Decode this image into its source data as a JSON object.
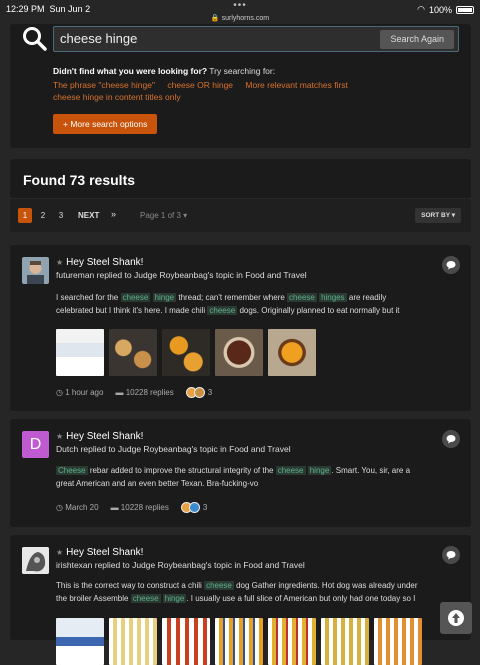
{
  "status": {
    "time": "12:29 PM",
    "date": "Sun Jun 2",
    "url": "surlyhorns.com",
    "battery": "100%"
  },
  "search": {
    "query": "cheese hinge",
    "button": "Search Again"
  },
  "suggestions": {
    "lead_bold": "Didn't find what you were looking for?",
    "lead": " Try searching for:",
    "items": [
      "The phrase \"cheese hinge\"",
      "cheese OR hinge",
      "More relevant matches first",
      "cheese hinge in content titles only"
    ]
  },
  "more_options": "More search options",
  "results_title": "Found 73 results",
  "pager": {
    "pages": [
      "1",
      "2",
      "3"
    ],
    "next": "NEXT",
    "last": "»",
    "page_of": "Page 1 of 3 ▾",
    "sort": "SORT BY ▾"
  },
  "results": [
    {
      "title": "Hey Steel Shank!",
      "sub": "futureman replied to Judge Roybeanbag's topic in Food and Travel",
      "time": "1 hour ago",
      "replies": "10228 replies",
      "reactions": "3"
    },
    {
      "title": "Hey Steel Shank!",
      "sub": "Dutch replied to Judge Roybeanbag's topic in Food and Travel",
      "avatar_letter": "D",
      "time": "March 20",
      "replies": "10228 replies",
      "reactions": "3"
    },
    {
      "title": "Hey Steel Shank!",
      "sub": "irishtexan replied to Judge Roybeanbag's topic in Food and Travel"
    }
  ],
  "body_words": {
    "r1a": "I searched for the",
    "r1b": "cheese",
    "r1c": "hinge",
    "r1d": "thread; can't remember where",
    "r1e": "cheese",
    "r1f": "hinges",
    "r1g": "are readily",
    "r1h": "celebrated but I think it's here. I made chili",
    "r1i": "cheese",
    "r1j": "dogs. Originally planned to eat normally but it",
    "r2a": "Cheese",
    "r2b": "rebar added to improve the structural integrity of the",
    "r2c": "cheese",
    "r2d": "hinge",
    "r2e": ". Smart. You, sir, are a",
    "r2f": "great American and an even better Texan. Bra-fucking-vo",
    "r3a": "This is the correct way to construct a chili",
    "r3b": "cheese",
    "r3c": "dog Gather ingredients. Hot dog was already under",
    "r3d": "the broiler Assemble",
    "r3e": "cheese",
    "r3f": "hinge",
    "r3g": ". I usually use a full slice of American but only had one today so I"
  },
  "colors": {
    "accent": "#c8530a",
    "link": "#d8722d",
    "highlight": "#5db18a",
    "panel": "#1b1b1b",
    "bg": "#262626"
  }
}
